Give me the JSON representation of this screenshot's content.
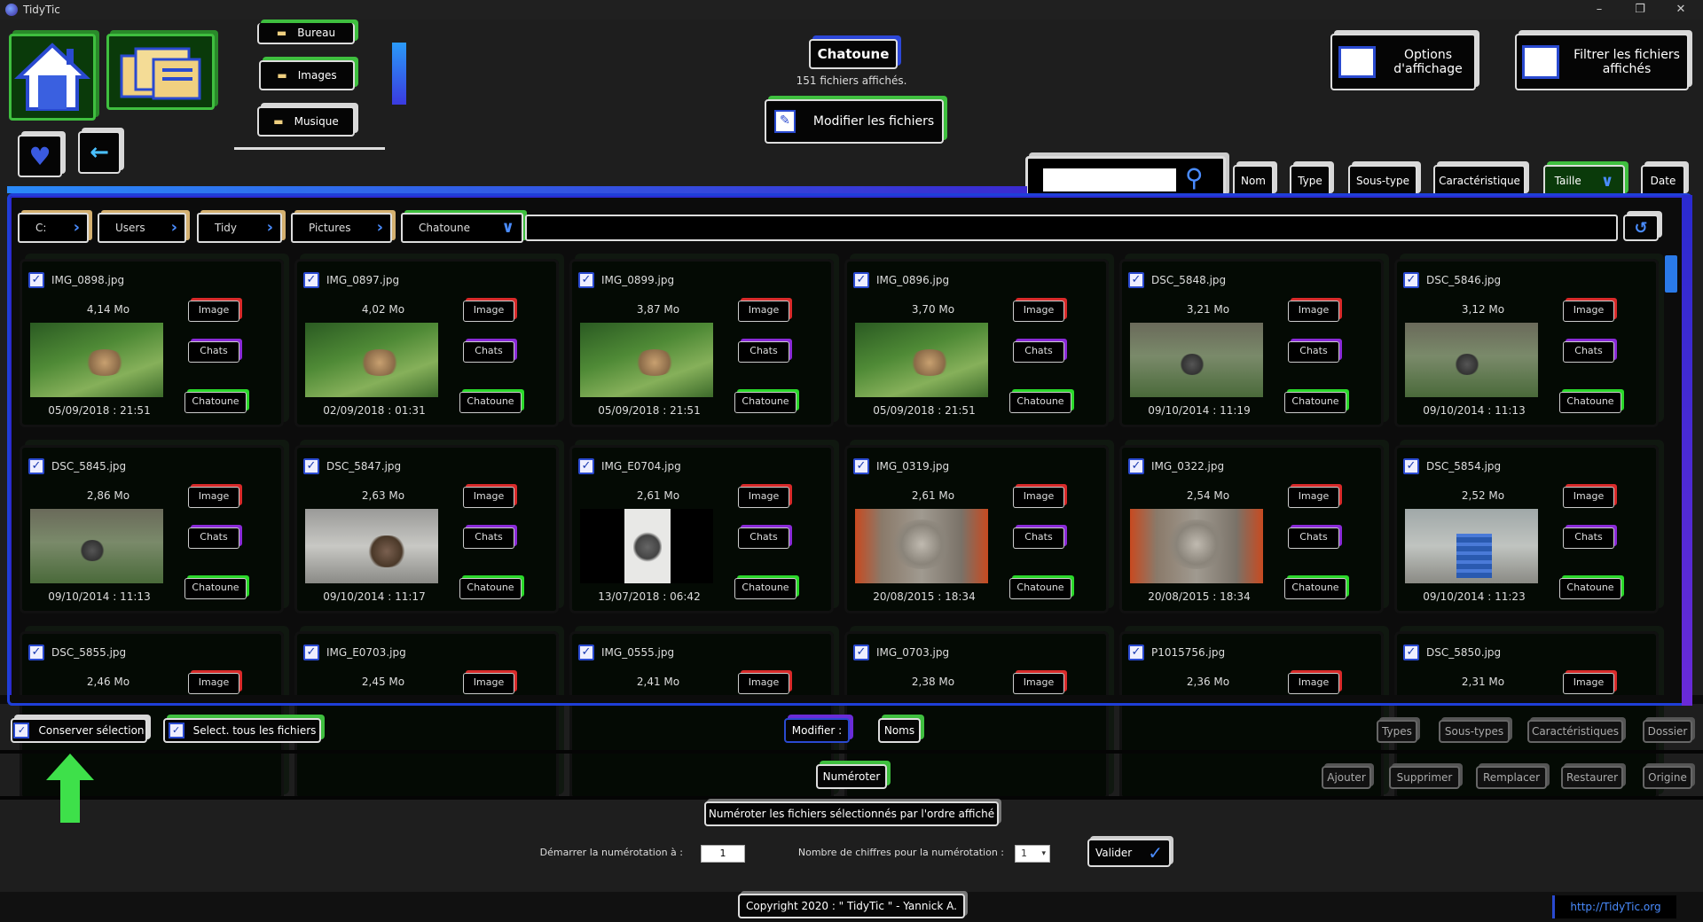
{
  "window": {
    "title": "TidyTic",
    "minimize": "–",
    "restore": "❐",
    "close": "✕"
  },
  "folders": {
    "bureau": "Bureau",
    "images": "Images",
    "musique": "Musique"
  },
  "current": {
    "folder_label": "Chatoune",
    "count_text": "151 fichiers affichés.",
    "modify_files": "Modifier les fichiers"
  },
  "top_right": {
    "options": "Options d'affichage",
    "filter": "Filtrer les fichiers affichés"
  },
  "sort": {
    "nom": "Nom",
    "type": "Type",
    "soustype": "Sous-type",
    "carac": "Caractéristique",
    "taille": "Taille",
    "date": "Date"
  },
  "breadcrumb": [
    "C:",
    "Users",
    "Tidy",
    "Pictures",
    "Chatoune"
  ],
  "files": [
    {
      "name": "IMG_0898.jpg",
      "size": "4,14 Mo",
      "date": "05/09/2018 : 21:51",
      "type": "Image",
      "subtype": "Chats",
      "feature": "Chatoune",
      "thumb": "grass"
    },
    {
      "name": "IMG_0897.jpg",
      "size": "4,02 Mo",
      "date": "02/09/2018 : 01:31",
      "type": "Image",
      "subtype": "Chats",
      "feature": "Chatoune",
      "thumb": "grass"
    },
    {
      "name": "IMG_0899.jpg",
      "size": "3,87 Mo",
      "date": "05/09/2018 : 21:51",
      "type": "Image",
      "subtype": "Chats",
      "feature": "Chatoune",
      "thumb": "grass"
    },
    {
      "name": "IMG_0896.jpg",
      "size": "3,70 Mo",
      "date": "05/09/2018 : 21:51",
      "type": "Image",
      "subtype": "Chats",
      "feature": "Chatoune",
      "thumb": "grass"
    },
    {
      "name": "DSC_5848.jpg",
      "size": "3,21 Mo",
      "date": "09/10/2014 : 11:19",
      "type": "Image",
      "subtype": "Chats",
      "feature": "Chatoune",
      "thumb": "yard"
    },
    {
      "name": "DSC_5846.jpg",
      "size": "3,12 Mo",
      "date": "09/10/2014 : 11:13",
      "type": "Image",
      "subtype": "Chats",
      "feature": "Chatoune",
      "thumb": "yard"
    },
    {
      "name": "DSC_5845.jpg",
      "size": "2,86 Mo",
      "date": "09/10/2014 : 11:13",
      "type": "Image",
      "subtype": "Chats",
      "feature": "Chatoune",
      "thumb": "yard"
    },
    {
      "name": "DSC_5847.jpg",
      "size": "2,63 Mo",
      "date": "09/10/2014 : 11:17",
      "type": "Image",
      "subtype": "Chats",
      "feature": "Chatoune",
      "thumb": "pale"
    },
    {
      "name": "IMG_E0704.jpg",
      "size": "2,61 Mo",
      "date": "13/07/2018 : 06:42",
      "type": "Image",
      "subtype": "Chats",
      "feature": "Chatoune",
      "thumb": "white"
    },
    {
      "name": "IMG_0319.jpg",
      "size": "2,61 Mo",
      "date": "20/08/2015 : 18:34",
      "type": "Image",
      "subtype": "Chats",
      "feature": "Chatoune",
      "thumb": "furry"
    },
    {
      "name": "IMG_0322.jpg",
      "size": "2,54 Mo",
      "date": "20/08/2015 : 18:34",
      "type": "Image",
      "subtype": "Chats",
      "feature": "Chatoune",
      "thumb": "furry"
    },
    {
      "name": "DSC_5854.jpg",
      "size": "2,52 Mo",
      "date": "09/10/2014 : 11:23",
      "type": "Image",
      "subtype": "Chats",
      "feature": "Chatoune",
      "thumb": "blue"
    },
    {
      "name": "DSC_5855.jpg",
      "size": "2,46 Mo",
      "date": "",
      "type": "Image",
      "subtype": "",
      "feature": "",
      "thumb": ""
    },
    {
      "name": "IMG_E0703.jpg",
      "size": "2,45 Mo",
      "date": "",
      "type": "Image",
      "subtype": "",
      "feature": "",
      "thumb": ""
    },
    {
      "name": "IMG_0555.jpg",
      "size": "2,41 Mo",
      "date": "",
      "type": "Image",
      "subtype": "",
      "feature": "",
      "thumb": ""
    },
    {
      "name": "IMG_0703.jpg",
      "size": "2,38 Mo",
      "date": "",
      "type": "Image",
      "subtype": "",
      "feature": "",
      "thumb": ""
    },
    {
      "name": "P1015756.jpg",
      "size": "2,36 Mo",
      "date": "",
      "type": "Image",
      "subtype": "",
      "feature": "",
      "thumb": ""
    },
    {
      "name": "DSC_5850.jpg",
      "size": "2,31 Mo",
      "date": "",
      "type": "Image",
      "subtype": "",
      "feature": "",
      "thumb": ""
    }
  ],
  "selection": {
    "keep": "Conserver sélection",
    "select_all": "Select. tous les fichiers"
  },
  "modify": {
    "label": "Modifier :",
    "noms": "Noms",
    "types": "Types",
    "soustypes": "Sous-types",
    "caracs": "Caractéristiques",
    "dossier": "Dossier"
  },
  "actions": {
    "numeroter": "Numéroter",
    "ajouter": "Ajouter",
    "supprimer": "Supprimer",
    "remplacer": "Remplacer",
    "restaurer": "Restaurer",
    "origine": "Origine"
  },
  "numbering": {
    "description": "Numéroter les fichiers sélectionnés par l'ordre affiché",
    "start_label": "Démarrer la numérotation à :",
    "start_value": "1",
    "digits_label": "Nombre de chiffres pour la numérotation :",
    "digits_value": "1",
    "validate": "Valider"
  },
  "footer": {
    "copyright": "Copyright 2020 : \" TidyTic \" - Yannick A.",
    "link": "http://TidyTic.org"
  }
}
